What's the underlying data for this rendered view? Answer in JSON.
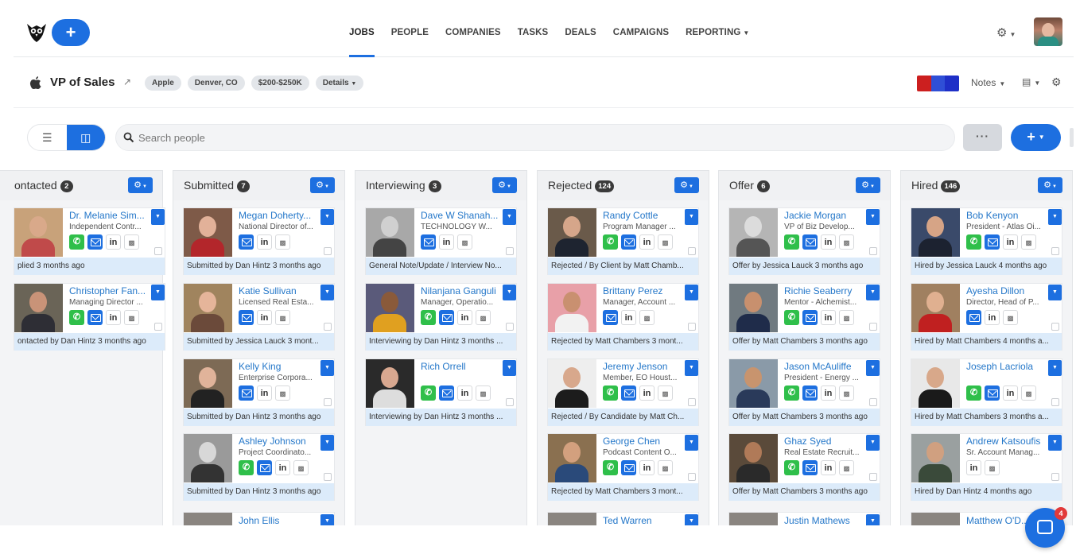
{
  "nav": {
    "add_label": "+",
    "items": [
      {
        "label": "JOBS",
        "active": true
      },
      {
        "label": "PEOPLE"
      },
      {
        "label": "COMPANIES"
      },
      {
        "label": "TASKS"
      },
      {
        "label": "DEALS"
      },
      {
        "label": "CAMPAIGNS"
      },
      {
        "label": "REPORTING",
        "dropdown": true
      }
    ],
    "settings_icon": "gear-icon",
    "logo_icon": "owl-logo-icon"
  },
  "job": {
    "title": "VP of Sales",
    "company_icon": "apple-logo-icon",
    "tags": [
      "Apple",
      "Denver, CO",
      "$200-$250K",
      "Details"
    ],
    "flag_colors": [
      "#cc1f1f",
      "#2f4fd6",
      "#1e2fc7"
    ],
    "notes_label": "Notes"
  },
  "toolbar": {
    "search_placeholder": "Search people",
    "more_label": "···",
    "add_label": "+"
  },
  "columns": [
    {
      "title": "ontacted",
      "count": "2",
      "cards": [
        {
          "name": "Dr. Melanie Sim...",
          "role": "Independent Contr...",
          "status": "plied 3 months ago",
          "icons": [
            "phone",
            "mail",
            "li",
            "cv"
          ],
          "skin": "#d9a98a",
          "shirt": "#c04a4a",
          "bg": "#c8a27a"
        },
        {
          "name": "Christopher Fan...",
          "role": "Managing Director ...",
          "status": "ontacted by Dan Hintz 3 months ago",
          "icons": [
            "phone",
            "mail",
            "li",
            "cv"
          ],
          "skin": "#c99378",
          "shirt": "#2e2e35",
          "bg": "#6a6457"
        }
      ]
    },
    {
      "title": "Submitted",
      "count": "7",
      "cards": [
        {
          "name": "Megan Doherty...",
          "role": "National Director of...",
          "status": "Submitted by Dan Hintz 3 months ago",
          "icons": [
            "mail",
            "li",
            "cv"
          ],
          "skin": "#e2b199",
          "shirt": "#b3262b",
          "bg": "#7e5a48"
        },
        {
          "name": "Katie Sullivan",
          "role": "Licensed Real Esta...",
          "status": "Submitted by Jessica Lauck 3 mont...",
          "icons": [
            "mail",
            "li",
            "cv"
          ],
          "skin": "#e5b59a",
          "shirt": "#6b4a3a",
          "bg": "#a0845e"
        },
        {
          "name": "Kelly King",
          "role": "Enterprise Corpora...",
          "status": "Submitted by Dan Hintz 3 months ago",
          "icons": [
            "mail",
            "li",
            "cv"
          ],
          "skin": "#e0b39a",
          "shirt": "#222",
          "bg": "#7d6a55"
        },
        {
          "name": "Ashley Johnson",
          "role": "Project Coordinato...",
          "status": "Submitted by Dan Hintz 3 months ago",
          "icons": [
            "phone",
            "mail",
            "li",
            "cv"
          ],
          "skin": "#d8d8d8",
          "shirt": "#333",
          "bg": "#9a9a9a"
        }
      ],
      "cutoff": "John Ellis"
    },
    {
      "title": "Interviewing",
      "count": "3",
      "cards": [
        {
          "name": "Dave W Shanah...",
          "role": "TECHNOLOGY W...",
          "status": "General Note/Update / Interview No...",
          "icons": [
            "mail",
            "li",
            "cv"
          ],
          "skin": "#d0d0d0",
          "shirt": "#444",
          "bg": "#a8a8a8"
        },
        {
          "name": "Nilanjana Ganguli",
          "role": "Manager, Operatio...",
          "status": "Interviewing by Dan Hintz 3 months ...",
          "icons": [
            "phone",
            "mail",
            "li",
            "cv"
          ],
          "skin": "#8a5a3a",
          "shirt": "#e0a020",
          "bg": "#5a5a7a"
        },
        {
          "name": "Rich Orrell",
          "role": "",
          "status": "Interviewing by Dan Hintz 3 months ...",
          "icons": [
            "phone",
            "mail",
            "li",
            "cv"
          ],
          "skin": "#d8a890",
          "shirt": "#ddd",
          "bg": "#2a2a2a"
        }
      ]
    },
    {
      "title": "Rejected",
      "count": "124",
      "cards": [
        {
          "name": "Randy Cottle",
          "role": "Program Manager ...",
          "status": "Rejected / By Client by Matt Chamb...",
          "icons": [
            "phone",
            "mail",
            "li",
            "cv"
          ],
          "skin": "#d6a68a",
          "shirt": "#1e2430",
          "bg": "#6a5a4a"
        },
        {
          "name": "Brittany Perez",
          "role": "Manager, Account ...",
          "status": "Rejected by Matt Chambers 3 mont...",
          "icons": [
            "mail",
            "li",
            "cv"
          ],
          "skin": "#c99070",
          "shirt": "#f2f2f2",
          "bg": "#e8a0a8"
        },
        {
          "name": "Jeremy Jenson",
          "role": "Member, EO Houst...",
          "status": "Rejected / By Candidate by Matt Ch...",
          "icons": [
            "phone",
            "mail",
            "li",
            "cv"
          ],
          "skin": "#d8a88c",
          "shirt": "#1c1c1c",
          "bg": "#eeeeee"
        },
        {
          "name": "George Chen",
          "role": "Podcast Content O...",
          "status": "Rejected by Matt Chambers 3 mont...",
          "icons": [
            "phone",
            "mail",
            "li",
            "cv"
          ],
          "skin": "#d3a07e",
          "shirt": "#2a4a7a",
          "bg": "#8a7050"
        }
      ],
      "cutoff": "Ted Warren"
    },
    {
      "title": "Offer",
      "count": "6",
      "cards": [
        {
          "name": "Jackie Morgan",
          "role": "VP of Biz Develop...",
          "status": "Offer by Jessica Lauck 3 months ago",
          "icons": [
            "phone",
            "mail",
            "li",
            "cv"
          ],
          "skin": "#dcdcdc",
          "shirt": "#555",
          "bg": "#b5b5b5"
        },
        {
          "name": "Richie Seaberry",
          "role": "Mentor - Alchemist...",
          "status": "Offer by Matt Chambers 3 months ago",
          "icons": [
            "phone",
            "mail",
            "li",
            "cv"
          ],
          "skin": "#c8906e",
          "shirt": "#1f2c4a",
          "bg": "#707a80"
        },
        {
          "name": "Jason McAuliffe",
          "role": "President - Energy ...",
          "status": "Offer by Matt Chambers 3 months ago",
          "icons": [
            "phone",
            "mail",
            "li",
            "cv"
          ],
          "skin": "#c8946e",
          "shirt": "#2a3a5a",
          "bg": "#8a9aa8"
        },
        {
          "name": "Ghaz Syed",
          "role": "Real Estate Recruit...",
          "status": "Offer by Matt Chambers 3 months ago",
          "icons": [
            "phone",
            "mail",
            "li",
            "cv"
          ],
          "skin": "#b07a58",
          "shirt": "#2a2a2a",
          "bg": "#5a4a3a"
        }
      ],
      "cutoff": "Justin Mathews"
    },
    {
      "title": "Hired",
      "count": "146",
      "cards": [
        {
          "name": "Bob Kenyon",
          "role": "President - Atlas Oi...",
          "status": "Hired by Jessica Lauck 4 months ago",
          "icons": [
            "phone",
            "mail",
            "li",
            "cv"
          ],
          "skin": "#d6a486",
          "shirt": "#1c2230",
          "bg": "#3a4a6a"
        },
        {
          "name": "Ayesha Dillon",
          "role": "Director, Head of P...",
          "status": "Hired by Matt Chambers 4 months a...",
          "icons": [
            "mail",
            "li",
            "cv"
          ],
          "skin": "#e0b090",
          "shirt": "#c02020",
          "bg": "#a08060"
        },
        {
          "name": "Joseph Lacriola",
          "role": "",
          "status": "Hired by Matt Chambers 3 months a...",
          "icons": [
            "phone",
            "mail",
            "li",
            "cv"
          ],
          "skin": "#d8a88a",
          "shirt": "#1a1a1a",
          "bg": "#e8e8e8"
        },
        {
          "name": "Andrew Katsoufis",
          "role": "Sr. Account Manag...",
          "status": "Hired by Dan Hintz 4 months ago",
          "icons": [
            "li",
            "cv"
          ],
          "skin": "#d0a080",
          "shirt": "#3a4a3a",
          "bg": "#9aa0a0"
        }
      ],
      "cutoff": "Matthew O'D..."
    }
  ],
  "chat": {
    "badge": "4"
  }
}
